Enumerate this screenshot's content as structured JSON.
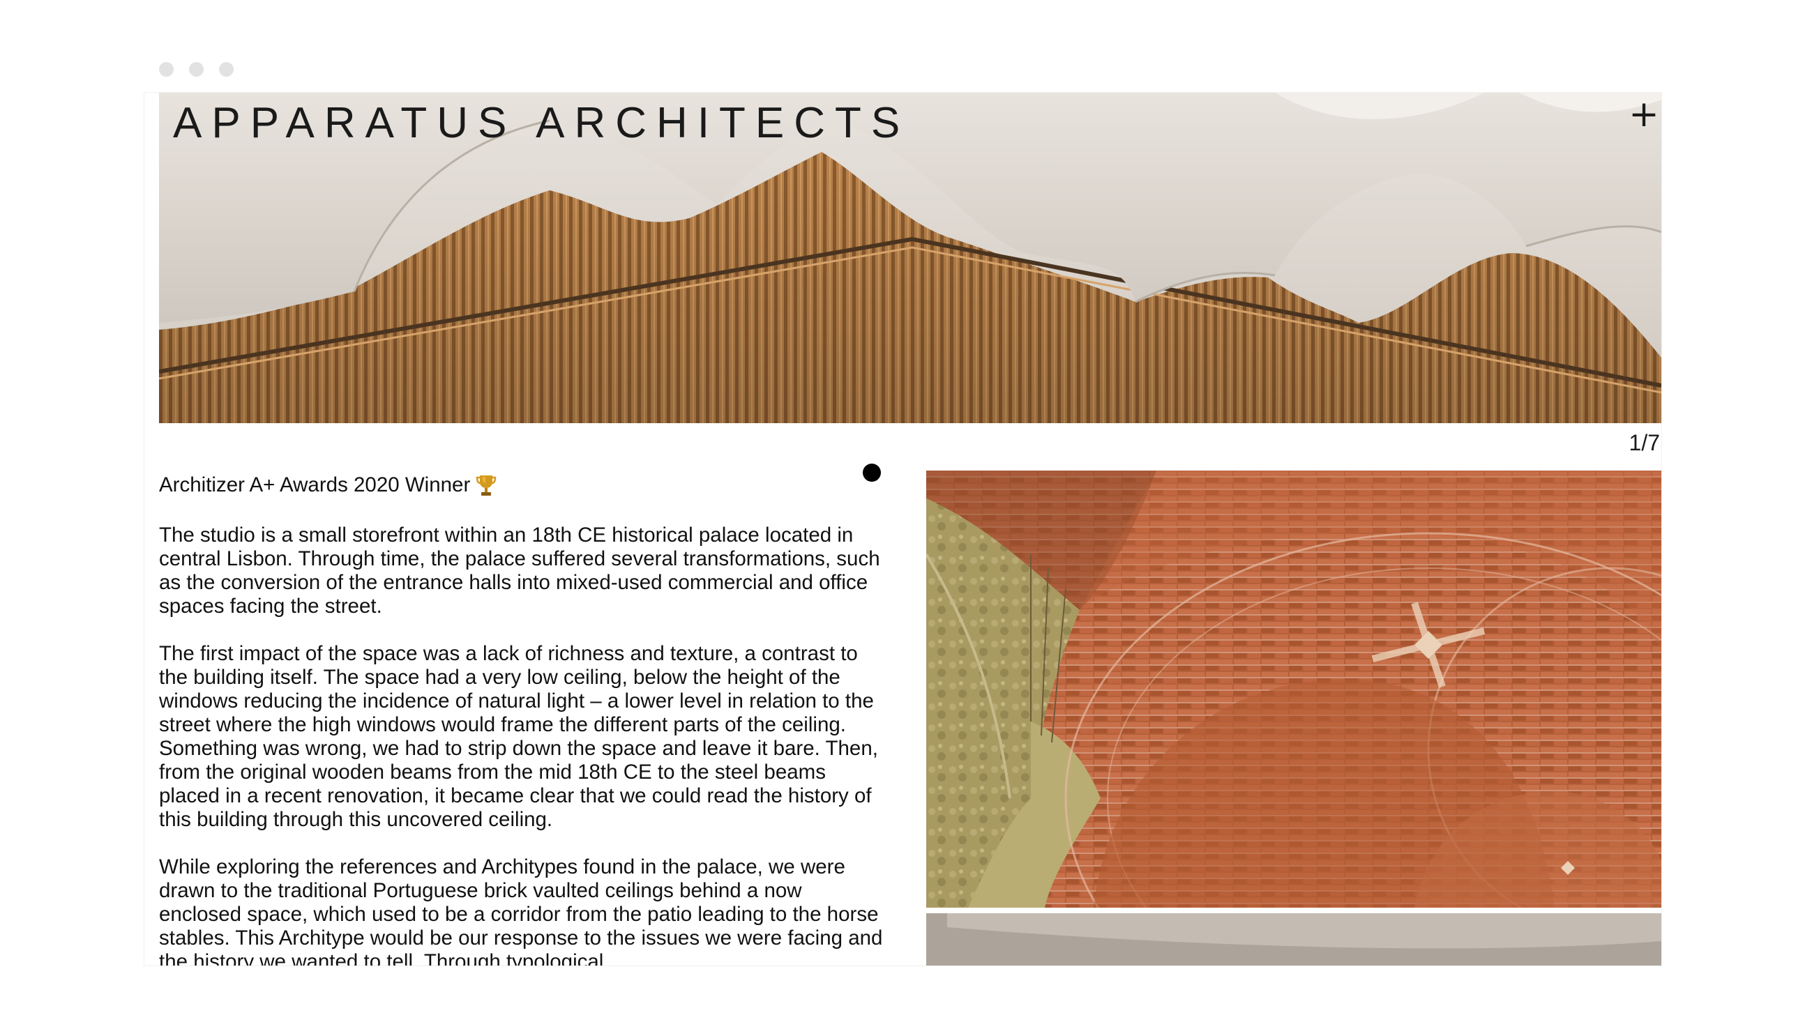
{
  "window": {
    "controls": [
      "dot",
      "dot",
      "dot"
    ]
  },
  "header": {
    "brand": "APPARATUS ARCHITECTS",
    "menu_icon": "plus-icon",
    "menu_label": "+"
  },
  "slideshow": {
    "counter": "1/7",
    "current": 1,
    "total": 7
  },
  "project": {
    "award": "Architizer A+ Awards 2020 Winner",
    "award_icon": "trophy-icon",
    "paragraphs": [
      "The studio is a small storefront within an 18th CE historical palace located in central Lisbon. Through time, the palace suffered several transformations, such as the conversion of the entrance halls into mixed-used commercial and office spaces facing the street.",
      "The first impact of the space was a lack of richness and texture, a contrast to the building itself. The space had a very low ceiling, below the height of the windows reducing the incidence of natural light – a lower level in relation to the street where the high windows would frame the different parts of the ceiling. Something was wrong, we had to strip down the space and leave it bare. Then, from the original wooden beams from the mid 18th CE to the steel beams placed in a recent renovation, it became clear that we could read the history of this building through this uncovered ceiling.",
      "While exploring the references and Architypes found in the palace, we were drawn to the traditional Portuguese brick vaulted ceilings behind a now enclosed space, which used to be a corridor from the patio leading to the horse stables. This Architype would be our response to the issues we were facing and the history we wanted to tell. Through typological"
    ]
  },
  "colors": {
    "accent": "#000000",
    "wood": "#b27a44",
    "brick": "#b75e36",
    "vault_plaster": "#dcd6cf"
  }
}
